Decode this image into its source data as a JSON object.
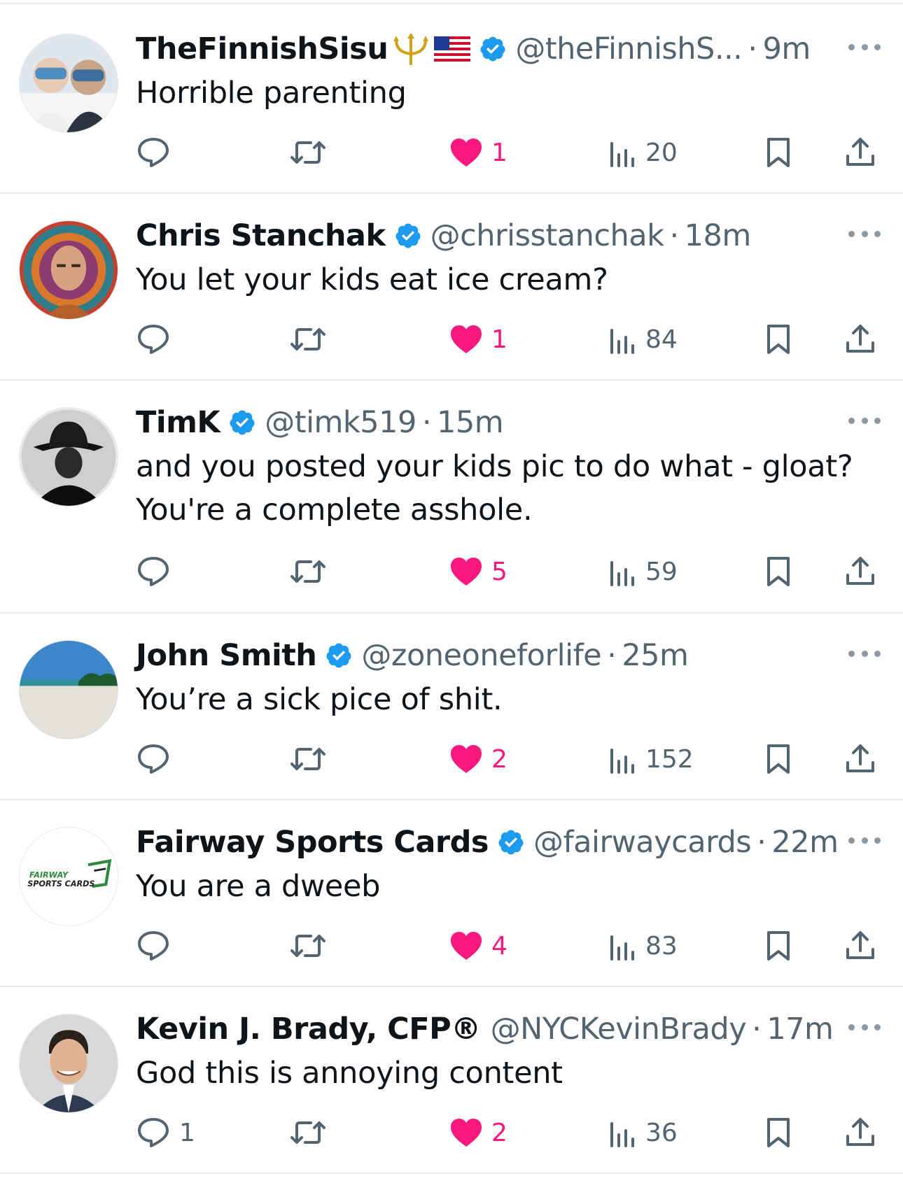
{
  "tweets": [
    {
      "name": "TheFinnishSisu",
      "emojis": "trident + us-flag",
      "handle": "@theFinnishS...",
      "time": "9m",
      "text": "Horrible parenting",
      "replies": "",
      "likes": "1",
      "views": "20",
      "avatar": "two-skiers-goggles"
    },
    {
      "name": "Chris Stanchak",
      "handle": "@chrisstanchak",
      "time": "18m",
      "text": "You let your kids eat ice cream?",
      "replies": "",
      "likes": "1",
      "views": "84",
      "avatar": "bald-man-psychedelic"
    },
    {
      "name": "TimK",
      "handle": "@timk519",
      "time": "15m",
      "text": "and you posted your kids pic to do what - gloat? You're a complete asshole.",
      "replies": "",
      "likes": "5",
      "views": "59",
      "avatar": "fedora-silhouette"
    },
    {
      "name": "John Smith",
      "handle": "@zoneoneforlife",
      "time": "25m",
      "text": "You’re a sick pice of shit.",
      "replies": "",
      "likes": "2",
      "views": "152",
      "avatar": "beach"
    },
    {
      "name": "Fairway Sports Cards",
      "handle": "@fairwaycards",
      "time": "22m",
      "text": "You are a dweeb",
      "replies": "",
      "likes": "4",
      "views": "83",
      "avatar": "fairway-logo",
      "logo_text_1": "FAIRWAY",
      "logo_text_2": "SPORTS CARDS"
    },
    {
      "name": "Kevin J. Brady, CFP®",
      "handle": "@NYCKevinBrady",
      "time": "17m",
      "text": "God this is annoying content",
      "replies": "1",
      "likes": "2",
      "views": "36",
      "avatar": "man-suit-smiling"
    }
  ],
  "separator": "·",
  "colors": {
    "verified": "#1d9bf0",
    "like": "#f91880",
    "icon": "#536471",
    "divider": "#e6e8ea"
  }
}
